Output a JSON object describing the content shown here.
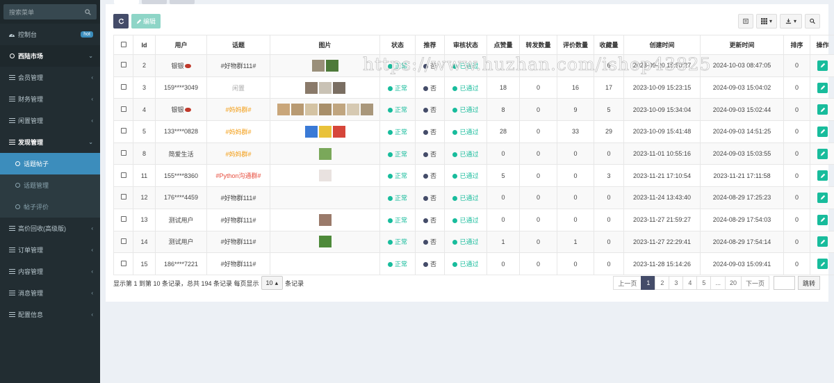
{
  "sidebar": {
    "search_placeholder": "搜索菜单",
    "items": [
      {
        "label": "控制台",
        "badge": "hot"
      },
      {
        "label": "西陆市场"
      },
      {
        "label": "会员管理"
      },
      {
        "label": "财务管理"
      },
      {
        "label": "闲置管理"
      },
      {
        "label": "发现管理"
      },
      {
        "label": "话题帖子"
      },
      {
        "label": "话题管理"
      },
      {
        "label": "帖子评价"
      },
      {
        "label": "高价回收(高级版)"
      },
      {
        "label": "订单管理"
      },
      {
        "label": "内容管理"
      },
      {
        "label": "消息管理"
      },
      {
        "label": "配置信息"
      }
    ]
  },
  "toolbar": {
    "edit_label": "编辑"
  },
  "table": {
    "headers": [
      "Id",
      "用户",
      "话题",
      "图片",
      "状态",
      "推荐",
      "审核状态",
      "点赞量",
      "转发数量",
      "评价数量",
      "收藏量",
      "创建时间",
      "更新时间",
      "排序",
      "操作"
    ],
    "rows": [
      {
        "id": "2",
        "user": "银银",
        "topic": "#好物群111#",
        "status": "正常",
        "recommend": "否",
        "audit": "已通过",
        "likes": "",
        "shares": "",
        "comments": "",
        "favs": "6",
        "created": "2023-09-20 15:50:27",
        "updated": "2024-10-03 08:47:05",
        "sort": "0"
      },
      {
        "id": "3",
        "user": "159****3049",
        "topic": "闲置",
        "status": "正常",
        "recommend": "否",
        "audit": "已通过",
        "likes": "18",
        "shares": "0",
        "comments": "16",
        "favs": "17",
        "created": "2023-10-09 15:23:15",
        "updated": "2024-09-03 15:04:02",
        "sort": "0"
      },
      {
        "id": "4",
        "user": "银银",
        "topic": "#妈妈群#",
        "status": "正常",
        "recommend": "否",
        "audit": "已通过",
        "likes": "8",
        "shares": "0",
        "comments": "9",
        "favs": "5",
        "created": "2023-10-09 15:34:04",
        "updated": "2024-09-03 15:02:44",
        "sort": "0"
      },
      {
        "id": "5",
        "user": "133****0828",
        "topic": "#妈妈群#",
        "status": "正常",
        "recommend": "否",
        "audit": "已通过",
        "likes": "28",
        "shares": "0",
        "comments": "33",
        "favs": "29",
        "created": "2023-10-09 15:41:48",
        "updated": "2024-09-03 14:51:25",
        "sort": "0"
      },
      {
        "id": "8",
        "user": "简爱生活",
        "topic": "#妈妈群#",
        "status": "正常",
        "recommend": "否",
        "audit": "已通过",
        "likes": "0",
        "shares": "0",
        "comments": "0",
        "favs": "0",
        "created": "2023-11-01 10:55:16",
        "updated": "2024-09-03 15:03:55",
        "sort": "0"
      },
      {
        "id": "11",
        "user": "155****8360",
        "topic": "#Python沟通群#",
        "status": "正常",
        "recommend": "否",
        "audit": "已通过",
        "likes": "5",
        "shares": "0",
        "comments": "0",
        "favs": "3",
        "created": "2023-11-21 17:10:54",
        "updated": "2023-11-21 17:11:58",
        "sort": "0"
      },
      {
        "id": "12",
        "user": "176****4459",
        "topic": "#好物群111#",
        "status": "正常",
        "recommend": "否",
        "audit": "已通过",
        "likes": "0",
        "shares": "0",
        "comments": "0",
        "favs": "0",
        "created": "2023-11-24 13:43:40",
        "updated": "2024-08-29 17:25:23",
        "sort": "0"
      },
      {
        "id": "13",
        "user": "测试用户",
        "topic": "#好物群111#",
        "status": "正常",
        "recommend": "否",
        "audit": "已通过",
        "likes": "0",
        "shares": "0",
        "comments": "0",
        "favs": "0",
        "created": "2023-11-27 21:59:27",
        "updated": "2024-08-29 17:54:03",
        "sort": "0"
      },
      {
        "id": "14",
        "user": "测试用户",
        "topic": "#好物群111#",
        "status": "正常",
        "recommend": "否",
        "audit": "已通过",
        "likes": "1",
        "shares": "0",
        "comments": "1",
        "favs": "0",
        "created": "2023-11-27 22:29:41",
        "updated": "2024-08-29 17:54:14",
        "sort": "0"
      },
      {
        "id": "15",
        "user": "186****7221",
        "topic": "#好物群111#",
        "status": "正常",
        "recommend": "否",
        "audit": "已通过",
        "likes": "0",
        "shares": "0",
        "comments": "0",
        "favs": "0",
        "created": "2023-11-28 15:14:26",
        "updated": "2024-09-03 15:09:41",
        "sort": "0"
      }
    ]
  },
  "footer": {
    "info": "显示第 1 到第 10 条记录，总共 194 条记录 每页显示",
    "page_size": "10",
    "records_suffix": "条记录",
    "prev": "上一页",
    "pages": [
      "1",
      "2",
      "3",
      "4",
      "5",
      "...",
      "20"
    ],
    "next": "下一页",
    "jump": "跳转"
  },
  "watermark": "https://www.huzhan.com/ishop43825",
  "colors": {
    "sidebar_bg": "#222d32",
    "active": "#3c8dbc",
    "success": "#18bc9c",
    "primary": "#444c69"
  }
}
